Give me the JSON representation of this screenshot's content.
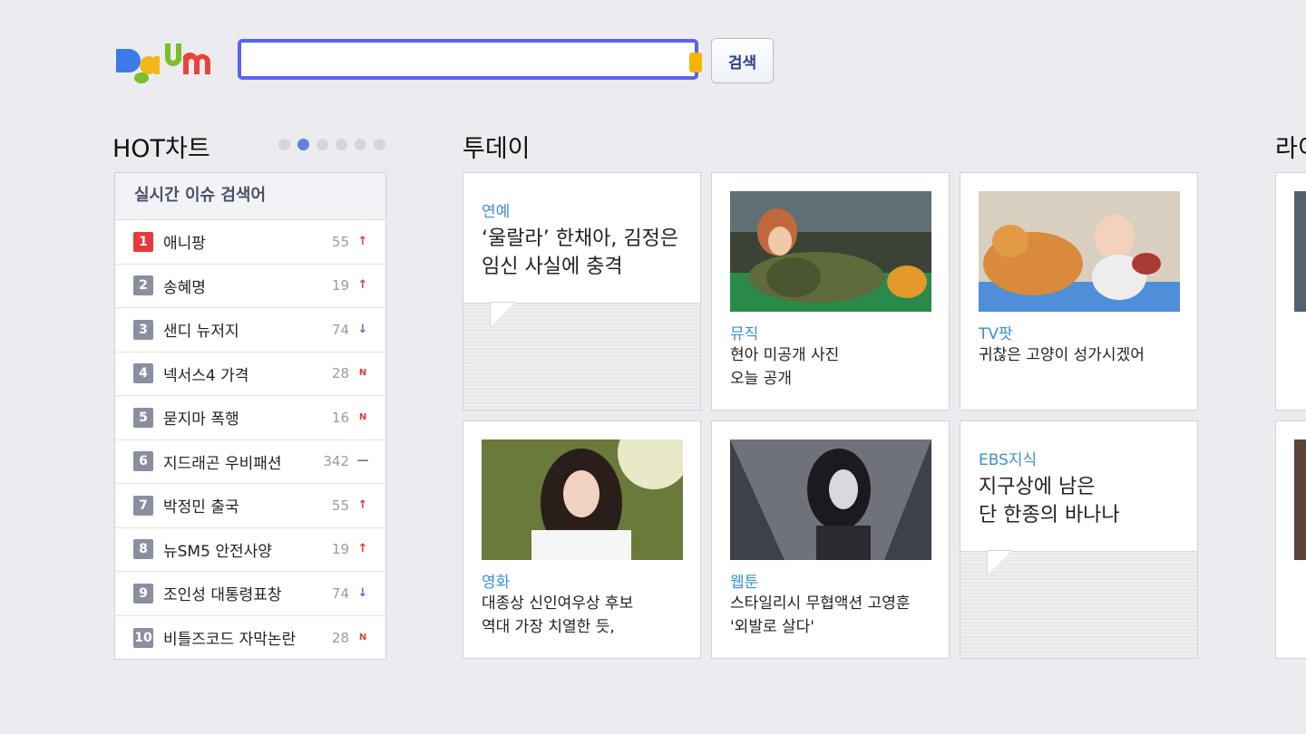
{
  "header": {
    "logo_text": "Daum",
    "search_placeholder": "",
    "search_button": "검색"
  },
  "hot_chart": {
    "title": "HOT차트",
    "page_count": 6,
    "active_page": 2,
    "panel_title": "실시간 이슈 검색어",
    "items": [
      {
        "rank": "1",
        "keyword": "애니팡",
        "count": "55",
        "trend": "up"
      },
      {
        "rank": "2",
        "keyword": "송혜명",
        "count": "19",
        "trend": "up"
      },
      {
        "rank": "3",
        "keyword": "샌디 뉴저지",
        "count": "74",
        "trend": "down"
      },
      {
        "rank": "4",
        "keyword": "넥서스4 가격",
        "count": "28",
        "trend": "new"
      },
      {
        "rank": "5",
        "keyword": "묻지마 폭행",
        "count": "16",
        "trend": "new"
      },
      {
        "rank": "6",
        "keyword": "지드래곤 우비패션",
        "count": "342",
        "trend": "same"
      },
      {
        "rank": "7",
        "keyword": "박정민 출국",
        "count": "55",
        "trend": "up"
      },
      {
        "rank": "8",
        "keyword": "뉴SM5 안전사양",
        "count": "19",
        "trend": "up"
      },
      {
        "rank": "9",
        "keyword": "조인성 대통령표창",
        "count": "74",
        "trend": "down"
      },
      {
        "rank": "10",
        "keyword": "비틀즈코드 자막논란",
        "count": "28",
        "trend": "new"
      }
    ]
  },
  "today": {
    "title": "투데이",
    "cards": [
      {
        "category": "연예",
        "text": "‘울랄라’ 한채아, 김정은 임신 사실에 충격"
      },
      {
        "category": "뮤직",
        "line1": "현아 미공개 사진",
        "line2": "오늘 공개"
      },
      {
        "category": "TV팟",
        "line1": "귀찮은 고양이 성가시겠어",
        "line2": ""
      },
      {
        "category": "영화",
        "line1": "대종상 신인여우상 후보",
        "line2": "역대 가장 치열한 듯,"
      },
      {
        "category": "웹툰",
        "line1": "스타일리시 무협액션 고영훈",
        "line2": "'외발로 살다'"
      },
      {
        "category": "EBS지식",
        "line1": "지구상에 남은",
        "line2": "단 한종의 바나나"
      }
    ]
  },
  "next_section": {
    "title": "라이"
  },
  "colors": {
    "background": "#ebebf0",
    "search_border": "#5a63f0",
    "category_blue": "#3d8fd8",
    "rank_first": "#e63a3a",
    "trend_up": "#e63a3a",
    "trend_down": "#5a6fd8"
  }
}
